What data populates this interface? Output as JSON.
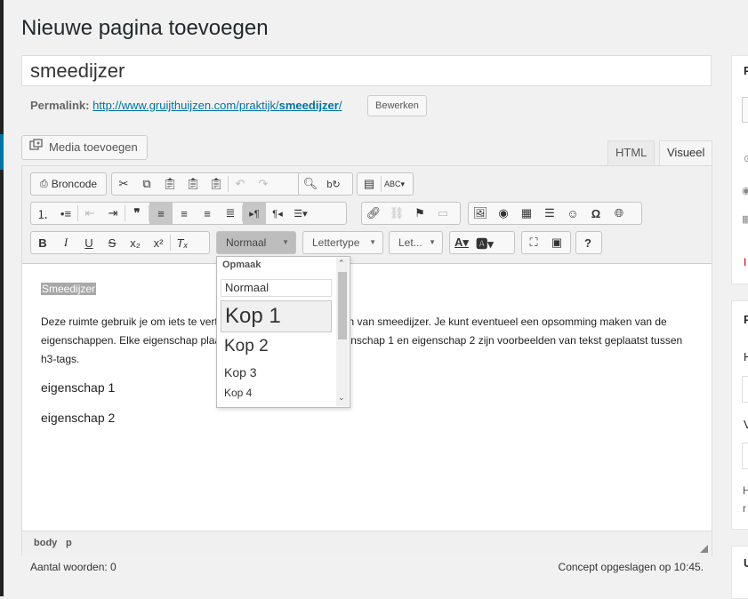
{
  "page": {
    "title": "Nieuwe pagina toevoegen"
  },
  "post": {
    "title": "smeedijzer",
    "permalink_label": "Permalink:",
    "permalink_base": "http://www.gruijthuijzen.com/praktijk/",
    "permalink_slug": "smeedijzer",
    "permalink_trailing": "/",
    "edit_button": "Bewerken"
  },
  "media": {
    "add_button": "Media toevoegen"
  },
  "tabs": {
    "html": "HTML",
    "visual": "Visueel"
  },
  "toolbar": {
    "source_button": "Broncode",
    "format_combo": "Normaal",
    "font_combo": "Lettertype",
    "size_combo": "Let...",
    "help": "?"
  },
  "content": {
    "heading1": "Smeedijzer",
    "paragraph": "Deze ruimte gebruik je om iets te vertellen over de eigenschappen van smeedijzer. Je kunt eventueel een opsomming maken van de eigenschappen. Elke eigenschap plaats je in een h3-kop. De eigenschap 1 en eigenschap 2 zijn voorbeelden van tekst geplaatst tussen h3-tags.",
    "heading3_a": "eigenschap 1",
    "heading3_b": "eigenschap 2"
  },
  "statusbar": {
    "path_body": "body",
    "path_p": "p"
  },
  "footer": {
    "word_count": "Aantal woorden: 0",
    "saved_status": "Concept opgeslagen op 10:45."
  },
  "format_dropdown": {
    "header": "Opmaak",
    "items": [
      "Normaal",
      "Kop 1",
      "Kop 2",
      "Kop 3",
      "Kop 4"
    ],
    "selected": "Kop 1"
  },
  "sidebar": {
    "letters": [
      "P",
      "P",
      "H",
      "V",
      "U",
      "H",
      "r",
      "I"
    ]
  }
}
